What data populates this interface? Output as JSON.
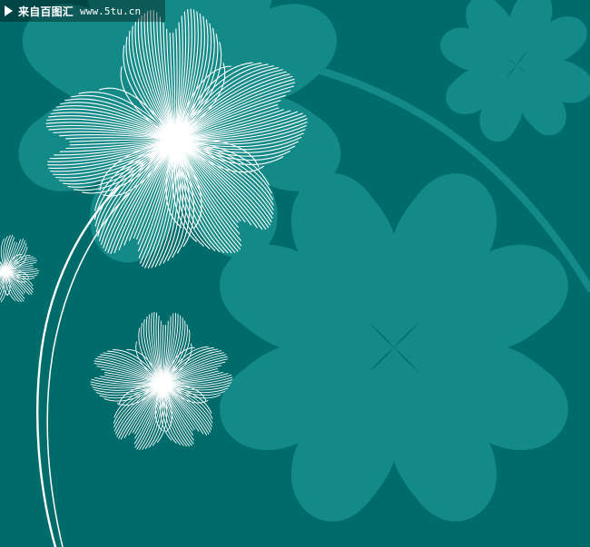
{
  "watermark": {
    "brand": "来自百图汇",
    "url": "www.5tu.cn",
    "icon": "play-triangle-icon"
  },
  "colors": {
    "background": "#006b6b",
    "solid_flower": "#138a88",
    "line_art": "#ffffff"
  }
}
